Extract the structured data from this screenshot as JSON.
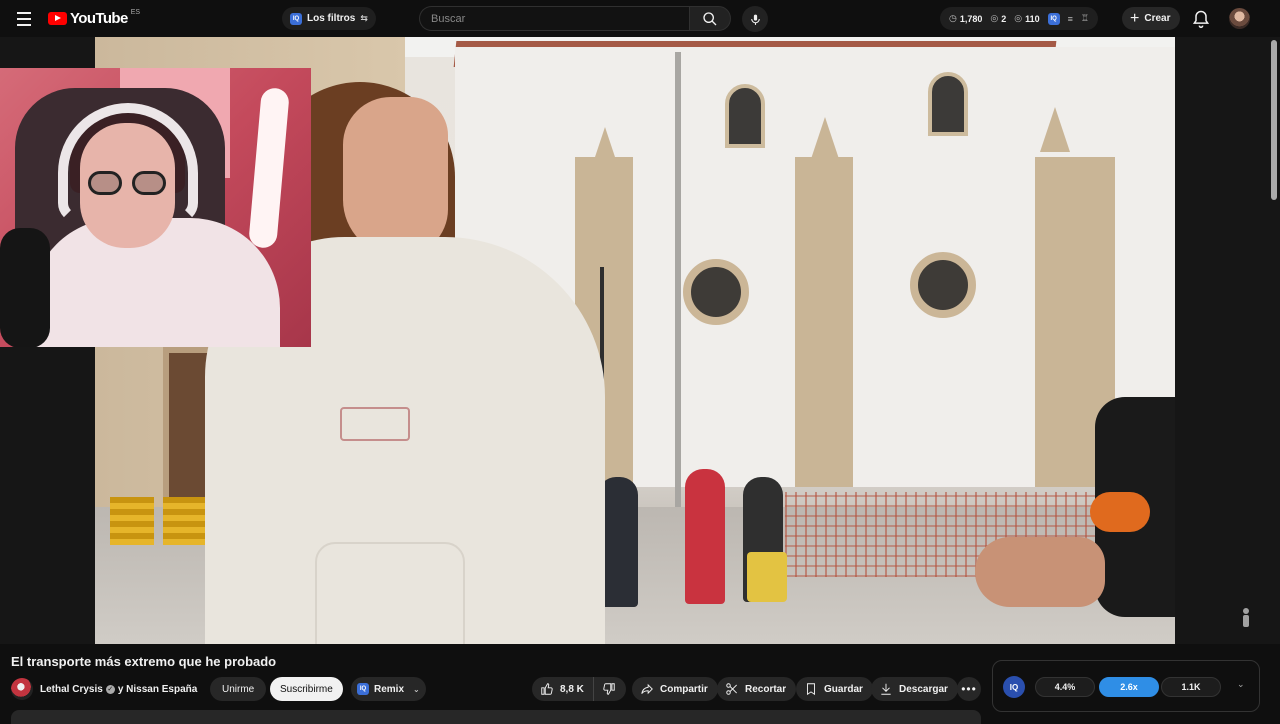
{
  "header": {
    "logo_text": "YouTube",
    "logo_region": "ES",
    "filters_chip": {
      "badge": "IQ",
      "label": "Los filtros"
    },
    "search": {
      "placeholder": "Buscar"
    },
    "stats": [
      {
        "icon": "clock-icon",
        "value": "1,780"
      },
      {
        "icon": "eye-icon",
        "value": "2"
      },
      {
        "icon": "eye-icon",
        "value": "110"
      }
    ],
    "stats_badge": "IQ",
    "create_label": "Crear"
  },
  "video": {
    "title": "El transporte más extremo que he probado"
  },
  "channel": {
    "name": "Lethal Crysis",
    "collab": "y Nissan España",
    "join_label": "Unirme",
    "subscribe_label": "Suscribirme",
    "remix": {
      "badge": "IQ",
      "label": "Remix"
    }
  },
  "actions": {
    "likes": "8,8 K",
    "share": "Compartir",
    "clip": "Recortar",
    "save": "Guardar",
    "download": "Descargar"
  },
  "iq_panel": {
    "logo": "IQ",
    "pills": [
      {
        "label": "4.4%",
        "active": false
      },
      {
        "label": "2.6x",
        "active": true
      },
      {
        "label": "1.1K",
        "active": false
      }
    ]
  },
  "colors": {
    "brand_red": "#ff0000",
    "accent_blue": "#2f8ee6",
    "background": "#0f0f0f"
  }
}
